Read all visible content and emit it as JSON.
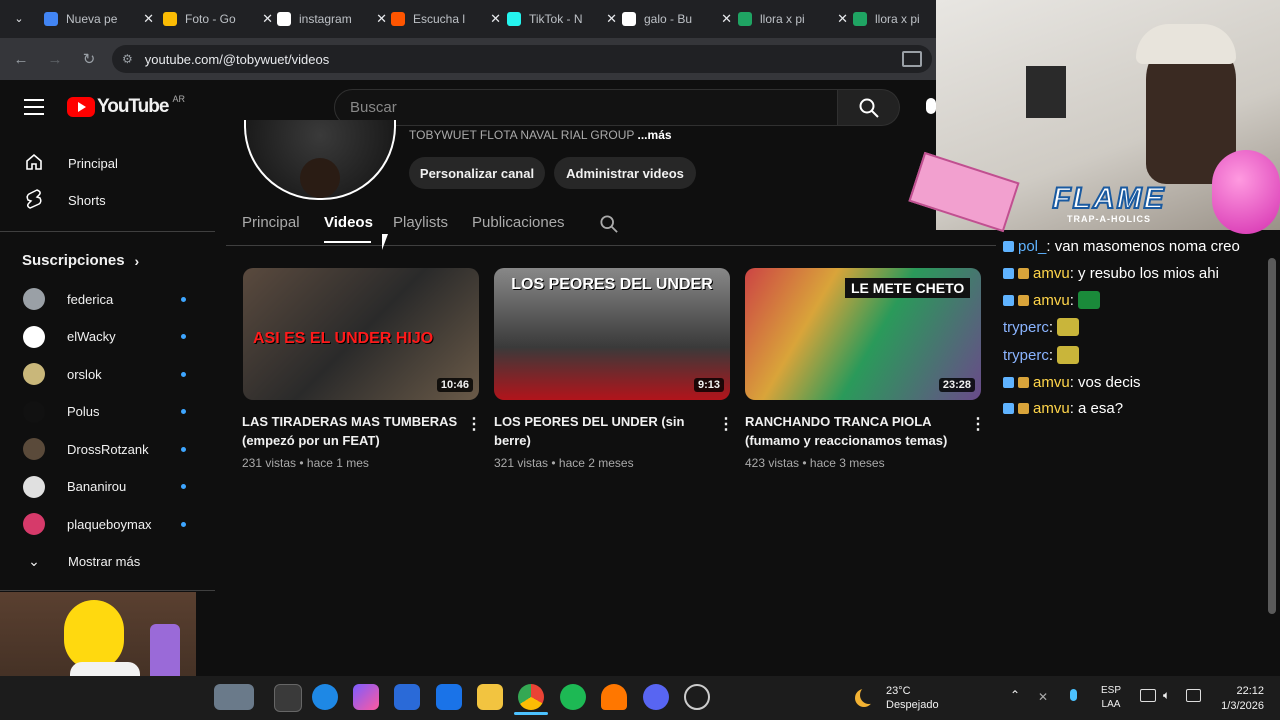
{
  "browser": {
    "tabs": [
      {
        "title": "Nueva pe",
        "color": "#4285f4"
      },
      {
        "title": "Foto - Go",
        "color": "#fbbc04"
      },
      {
        "title": "instagram",
        "color": "#ffffff"
      },
      {
        "title": "Escucha l",
        "color": "#ff5500"
      },
      {
        "title": "TikTok - N",
        "color": "#25f4ee"
      },
      {
        "title": "galo - Bu",
        "color": "#ffffff"
      },
      {
        "title": "llora x pi",
        "color": "#1fa463"
      },
      {
        "title": "llora x pi",
        "color": "#1fa463"
      }
    ],
    "url": "youtube.com/@tobywuet/videos"
  },
  "youtube": {
    "logo_text": "YouTube",
    "region": "AR",
    "search_placeholder": "Buscar",
    "sidebar": {
      "main": [
        {
          "label": "Principal",
          "icon": "home-icon"
        },
        {
          "label": "Shorts",
          "icon": "shorts-icon"
        }
      ],
      "subs_header": "Suscripciones",
      "subs": [
        {
          "name": "federica",
          "color": "#9aa0a6"
        },
        {
          "name": "elWacky",
          "color": "#ffffff"
        },
        {
          "name": "orslok",
          "color": "#c9b77a"
        },
        {
          "name": "Polus",
          "color": "#111111"
        },
        {
          "name": "DrossRotzank",
          "color": "#5a4a3a"
        },
        {
          "name": "Bananirou",
          "color": "#e0e0e0"
        },
        {
          "name": "plaqueboymax",
          "color": "#d63a6a"
        }
      ],
      "show_more": "Mostrar más"
    },
    "channel": {
      "handle_line": "TOBYWUET FLOTA NAVAL RIAL GROUP",
      "more": "...más",
      "buttons": [
        "Personalizar canal",
        "Administrar videos"
      ],
      "tabs": [
        "Principal",
        "Videos",
        "Playlists",
        "Publicaciones"
      ],
      "active_tab": "Videos"
    },
    "videos": [
      {
        "thumb_text": "ASI ES EL UNDER HIJO",
        "duration": "10:46",
        "title": "LAS TIRADERAS MAS TUMBERAS (empezó por un FEAT)",
        "meta": "231 vistas • hace 1 mes"
      },
      {
        "thumb_text": "LOS PEORES DEL UNDER",
        "duration": "9:13",
        "title": "LOS PEORES DEL UNDER (sin berre)",
        "meta": "321 vistas • hace 2 meses"
      },
      {
        "thumb_text": "LE METE CHETO",
        "duration": "23:28",
        "title": "RANCHANDO TRANCA PIOLA (fumamo y reaccionamos temas)",
        "meta": "423 vistas • hace 3 meses"
      }
    ]
  },
  "overlay": {
    "banner_title": "FLAME",
    "banner_sub": "TRAP-A-HOLICS",
    "chat": [
      {
        "user": "pol_",
        "text": "van masomenos noma creo",
        "color": "#5fb3ff"
      },
      {
        "user": "amvu",
        "text": "y resubo los mios ahi",
        "color": "#ffd54a"
      },
      {
        "user": "amvu",
        "text": "",
        "color": "#ffd54a"
      },
      {
        "user": "tryperc",
        "text": "",
        "color": "#8ab4ff"
      },
      {
        "user": "tryperc",
        "text": "",
        "color": "#8ab4ff"
      },
      {
        "user": "amvu",
        "text": "vos decis",
        "color": "#ffd54a"
      },
      {
        "user": "amvu",
        "text": "a esa?",
        "color": "#ffd54a"
      }
    ]
  },
  "taskbar": {
    "weather_temp": "23°C",
    "weather_desc": "Despejado",
    "lang_top": "ESP",
    "lang_bottom": "LAA",
    "time": "22:12",
    "date": "1/3/2026"
  }
}
